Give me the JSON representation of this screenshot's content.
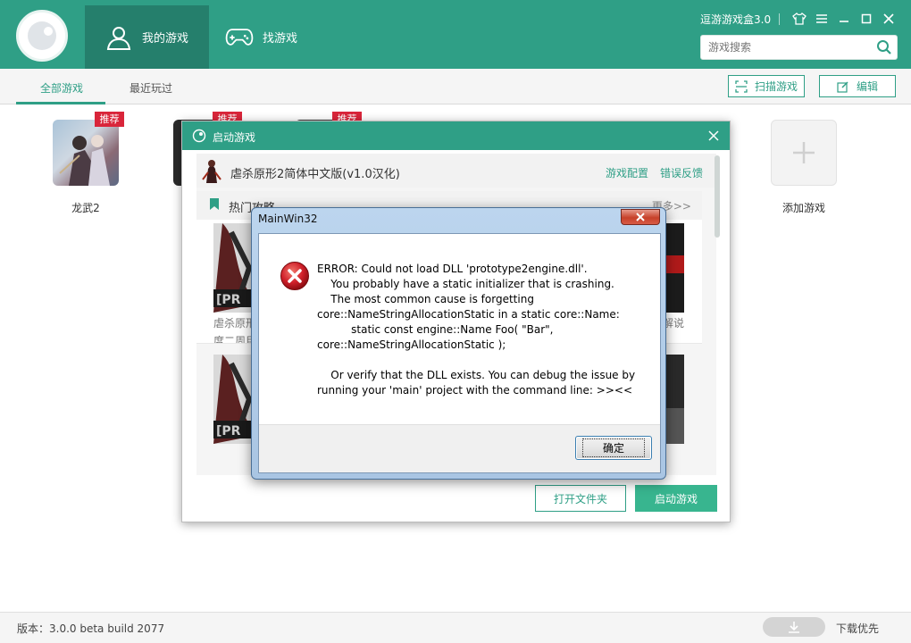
{
  "header": {
    "nav": [
      {
        "label": "我的游戏",
        "icon": "user-icon",
        "active": true
      },
      {
        "label": "找游戏",
        "icon": "gamepad-icon",
        "active": false
      }
    ],
    "app_title": "逗游游戏盒3.0",
    "search": {
      "placeholder": "游戏搜索",
      "value": ""
    },
    "window_controls": [
      "skin-icon",
      "menu-icon",
      "minimize-icon",
      "maximize-icon",
      "close-icon"
    ]
  },
  "subnav": {
    "tabs": [
      {
        "label": "全部游戏",
        "active": true
      },
      {
        "label": "最近玩过",
        "active": false
      }
    ],
    "scan_label": "扫描游戏",
    "edit_label": "编辑"
  },
  "games": [
    {
      "name": "龙武2",
      "badge": "推荐"
    },
    {
      "name": "",
      "badge": "推荐"
    },
    {
      "name": "",
      "badge": "推荐"
    }
  ],
  "add_game_label": "添加游戏",
  "launch_dialog": {
    "title": "启动游戏",
    "game_title": "虐杀原形2简体中文版(v1.0汉化)",
    "config_link": "游戏配置",
    "feedback_link": "错误反馈",
    "guides_title": "热门攻略",
    "more_label": "更多>>",
    "guide_snippets": [
      "虐杀原形",
      "度二周目"
    ],
    "guide_snippet_right": "解说",
    "open_folder_label": "打开文件夹",
    "launch_label": "启动游戏"
  },
  "error_dialog": {
    "caption": "MainWin32",
    "lines": [
      "ERROR: Could not load DLL 'prototype2engine.dll'.",
      "    You probably have a static initializer that is crashing.",
      "    The most common cause is forgetting",
      "core::NameStringAllocationStatic in a static core::Name:",
      "          static const engine::Name Foo( \"Bar\",",
      "core::NameStringAllocationStatic );",
      "",
      "    Or verify that the DLL exists. You can debug the issue by",
      "running your 'main' project with the command line: >><<"
    ],
    "ok_label": "确定"
  },
  "footer": {
    "version": "版本：3.0.0 beta build 2077",
    "download_label": "下载优先"
  },
  "colors": {
    "brand": "#2f9f86",
    "brand_dark": "#257f6c",
    "launch_button": "#38b58f",
    "badge": "#d9253a"
  }
}
